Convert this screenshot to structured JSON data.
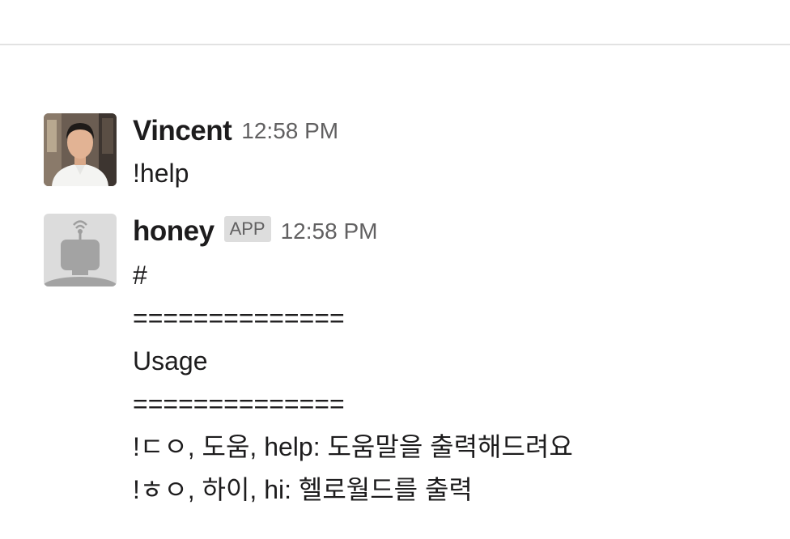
{
  "messages": [
    {
      "sender": "Vincent",
      "time": "12:58 PM",
      "lines": [
        "!help"
      ]
    },
    {
      "sender": "honey",
      "badge": "APP",
      "time": "12:58 PM",
      "lines": [
        "#",
        "==============",
        "Usage",
        "==============",
        "!ㄷㅇ, 도움, help: 도움말을 출력해드려요",
        "!ㅎㅇ, 하이, hi: 헬로월드를 출력"
      ]
    }
  ],
  "colors": {
    "text": "#1d1c1d",
    "muted": "#616061",
    "badge_bg": "#dddddd",
    "divider": "#e2e2e2"
  }
}
